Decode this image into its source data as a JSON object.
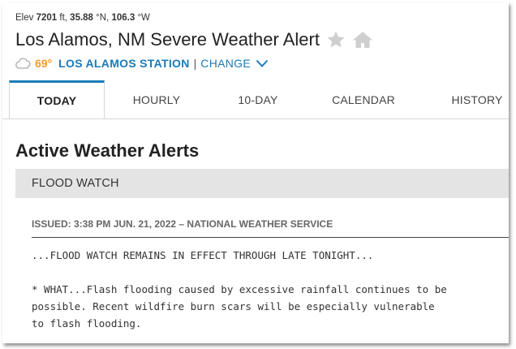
{
  "location": {
    "elev_label": "Elev",
    "elev_value": "7201",
    "elev_unit": "ft,",
    "lat_value": "35.88",
    "lat_unit": "°N,",
    "lon_value": "106.3",
    "lon_unit": "°W"
  },
  "header": {
    "title": "Los Alamos, NM Severe Weather Alert",
    "temperature": "69°",
    "station": "LOS ALAMOS STATION",
    "separator": "|",
    "change_label": "CHANGE"
  },
  "colors": {
    "accent_blue": "#1a7bb8",
    "temp_orange": "#f59a23",
    "alert_bar_bg": "#e4e4e4"
  },
  "icons": {
    "star": "star-icon",
    "home": "home-icon",
    "weather": "cloud-icon",
    "chevron": "chevron-down-icon"
  },
  "tabs": [
    {
      "label": "TODAY",
      "active": true
    },
    {
      "label": "HOURLY",
      "active": false
    },
    {
      "label": "10-DAY",
      "active": false
    },
    {
      "label": "CALENDAR",
      "active": false
    },
    {
      "label": "HISTORY",
      "active": false
    }
  ],
  "main": {
    "section_title": "Active Weather Alerts",
    "alert": {
      "name": "FLOOD WATCH",
      "issued": "ISSUED: 3:38 PM JUN. 21, 2022 – NATIONAL WEATHER SERVICE",
      "body": "...FLOOD WATCH REMAINS IN EFFECT THROUGH LATE TONIGHT...\n\n* WHAT...Flash flooding caused by excessive rainfall continues to be\npossible. Recent wildfire burn scars will be especially vulnerable\nto flash flooding."
    }
  }
}
